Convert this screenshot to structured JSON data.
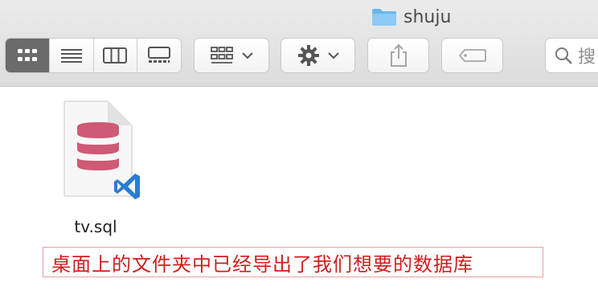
{
  "window": {
    "title": "shuju"
  },
  "toolbar": {
    "view_modes": [
      "icon-view",
      "list-view",
      "column-view",
      "gallery-view"
    ],
    "active_view": "icon-view",
    "group_button": "grid-group-icon",
    "action_button": "gear-icon",
    "share_button": "share-icon",
    "tag_button": "tag-icon",
    "search_placeholder": "搜"
  },
  "files": [
    {
      "name": "tv.sql",
      "icon": "database-sql-file-icon",
      "badge": "vscode-icon"
    }
  ],
  "annotation": {
    "text": "桌面上的文件夹中已经导出了我们想要的数据库"
  },
  "colors": {
    "db": "#cf5a75",
    "vscode": "#2a7cd3",
    "annotation": "#d01d1d"
  }
}
